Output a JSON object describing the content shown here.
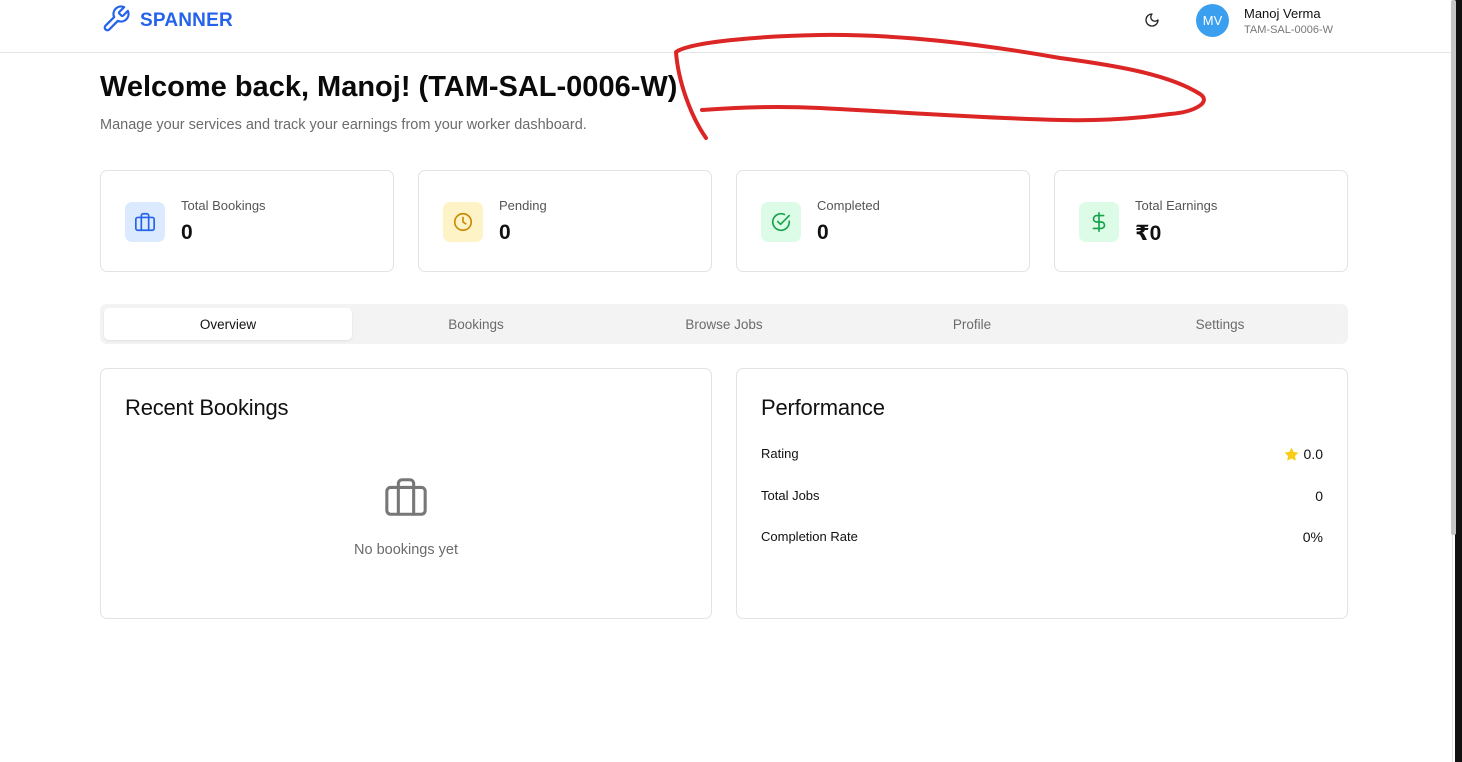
{
  "brand": {
    "name": "SPANNER"
  },
  "user": {
    "initials": "MV",
    "name": "Manoj Verma",
    "id": "TAM-SAL-0006-W"
  },
  "header": {
    "welcome": "Welcome back, Manoj! (TAM-SAL-0006-W)",
    "subtitle": "Manage your services and track your earnings from your worker dashboard."
  },
  "stats": [
    {
      "label": "Total Bookings",
      "value": "0",
      "icon": "briefcase-icon"
    },
    {
      "label": "Pending",
      "value": "0",
      "icon": "clock-icon"
    },
    {
      "label": "Completed",
      "value": "0",
      "icon": "check-circle-icon"
    },
    {
      "label": "Total Earnings",
      "value": "₹0",
      "icon": "dollar-icon"
    }
  ],
  "tabs": [
    "Overview",
    "Bookings",
    "Browse Jobs",
    "Profile",
    "Settings"
  ],
  "active_tab": "Overview",
  "recent_bookings": {
    "title": "Recent Bookings",
    "empty_text": "No bookings yet"
  },
  "performance": {
    "title": "Performance",
    "rows": [
      {
        "label": "Rating",
        "value": "0.0"
      },
      {
        "label": "Total Jobs",
        "value": "0"
      },
      {
        "label": "Completion Rate",
        "value": "0%"
      }
    ]
  },
  "colors": {
    "brand": "#2563eb",
    "avatar": "#3b9ff0",
    "annotation": "#dc2626",
    "icon_blue_bg": "#dbeafe",
    "icon_yellow_bg": "#fef3c7",
    "icon_green_bg": "#dcfce7",
    "star": "#facc15"
  }
}
